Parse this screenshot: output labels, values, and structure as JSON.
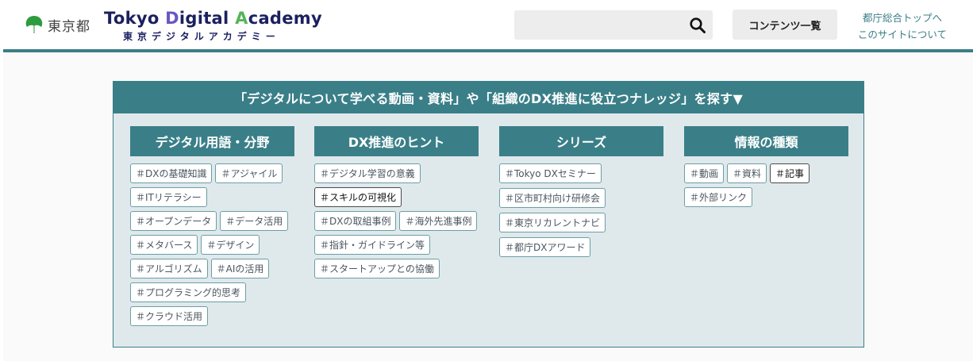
{
  "header": {
    "gov_logo_text": "東京都",
    "brand": {
      "part1": "Tokyo ",
      "part2": "D",
      "part3": "igital ",
      "part4": "A",
      "part5": "cademy"
    },
    "brand_sub": "東京デジタルアカデミー",
    "search": {
      "value": "",
      "placeholder": ""
    },
    "contents_button": "コンテンツ一覧",
    "links": [
      "都庁総合トップへ",
      "このサイトについて"
    ]
  },
  "panel": {
    "title": "「デジタルについて学べる動画・資料」や「組織のDX推進に役立つナレッジ」を探す▼",
    "columns": [
      {
        "heading": "デジタル用語・分野",
        "tags": [
          "＃DXの基礎知識",
          "＃アジャイル",
          "＃ITリテラシー",
          "＃オープンデータ",
          "＃データ活用",
          "＃メタバース",
          "＃デザイン",
          "＃アルゴリズム",
          "＃AIの活用",
          "＃プログラミング的思考",
          "＃クラウド活用"
        ]
      },
      {
        "heading": "DX推進のヒント",
        "tags": [
          "＃デジタル学習の意義",
          "＃スキルの可視化",
          "＃DXの取組事例",
          "＃海外先進事例",
          "＃指針・ガイドライン等",
          "＃スタートアップとの協働"
        ]
      },
      {
        "heading": "シリーズ",
        "tags": [
          "＃Tokyo DXセミナー",
          "＃区市町村向け研修会",
          "＃東京リカレントナビ",
          "＃都庁DXアワード"
        ]
      },
      {
        "heading": "情報の種類",
        "tags": [
          "＃動画",
          "＃資料",
          "＃記事",
          "＃外部リンク"
        ]
      }
    ]
  },
  "colors": {
    "accent": "#3a7f88",
    "panel_bg": "#dfe9ec",
    "brand_navy": "#1b2060"
  },
  "icons": {
    "search": "magnifier-icon",
    "logo": "tokyo-leaf-icon"
  }
}
